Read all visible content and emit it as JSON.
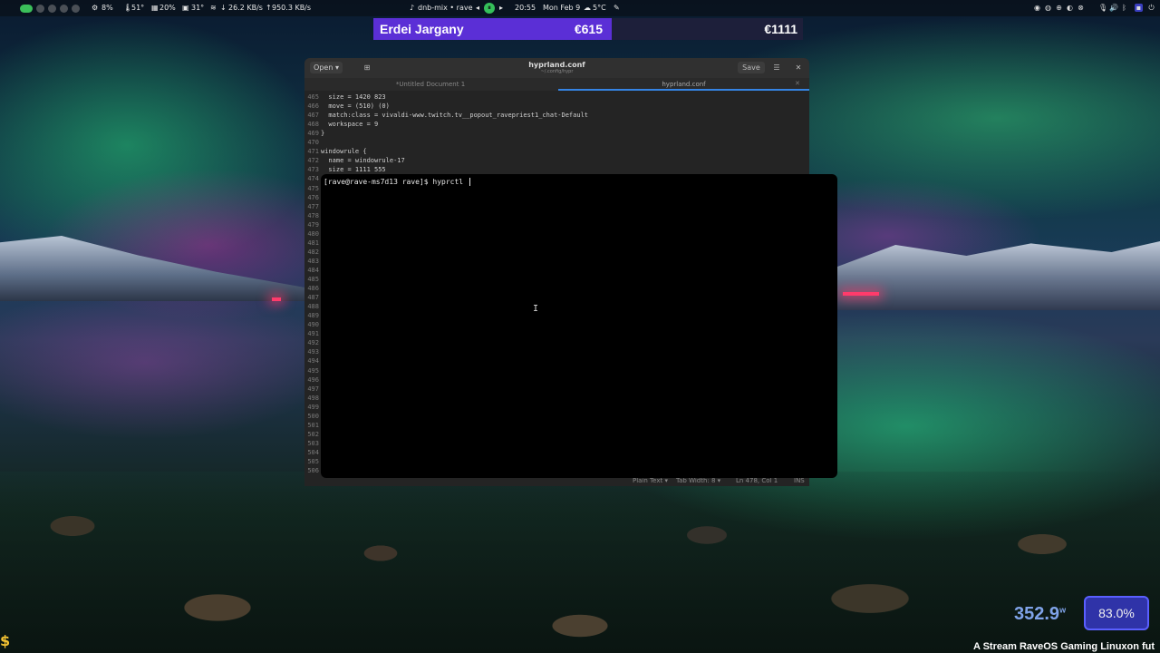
{
  "topbar": {
    "cpu_percent": "8%",
    "cpu_temp": "51°",
    "mem": "20%",
    "gpu_temp": "31°",
    "net_down": "26.2 KB/s",
    "net_up": "950.3 KB/s",
    "media": "dnb-mix • rave",
    "time": "20:55",
    "date": "Mon Feb 9",
    "weather": "5°C"
  },
  "banner": {
    "name": "Erdei Jargany",
    "amount": "€615",
    "total": "€1111"
  },
  "editor": {
    "title": "hyprland.conf",
    "subtitle": "~/.config/hypr",
    "open_label": "Open",
    "save_label": "Save",
    "tabs": [
      "*Untitled Document 1",
      "hyprland.conf"
    ],
    "lines": [
      {
        "n": "465",
        "t": "  size = 1420 823"
      },
      {
        "n": "466",
        "t": "  move = (510) (0)"
      },
      {
        "n": "467",
        "t": "  match:class = vivaldi-www.twitch.tv__popout_ravepriest1_chat-Default"
      },
      {
        "n": "468",
        "t": "  workspace = 9"
      },
      {
        "n": "469",
        "t": "}"
      },
      {
        "n": "470",
        "t": ""
      },
      {
        "n": "471",
        "t": "windowrule {"
      },
      {
        "n": "472",
        "t": "  name = windowrule-17"
      },
      {
        "n": "473",
        "t": "  size = 1111 555"
      }
    ],
    "gutter_numbers": [
      "474",
      "475",
      "476",
      "477",
      "478",
      "479",
      "480",
      "481",
      "482",
      "483",
      "484",
      "485",
      "486",
      "487",
      "488",
      "489",
      "490",
      "491",
      "492",
      "493",
      "494",
      "495",
      "496",
      "497",
      "498",
      "499",
      "500",
      "501",
      "502",
      "503",
      "504",
      "505",
      "506"
    ],
    "status": {
      "syntax": "Plain Text ▾",
      "tab_width": "Tab Width: 8 ▾",
      "position": "Ln 478, Col 1",
      "mode": "INS"
    }
  },
  "terminal": {
    "prompt": "[rave@rave-ms7d13 rave]$ hyprctl "
  },
  "widgets": {
    "power": "352.9",
    "power_unit": "w",
    "cpu_usage": "83.0%",
    "ticker": "A Stream RaveOS Gaming Linuxon fut"
  }
}
